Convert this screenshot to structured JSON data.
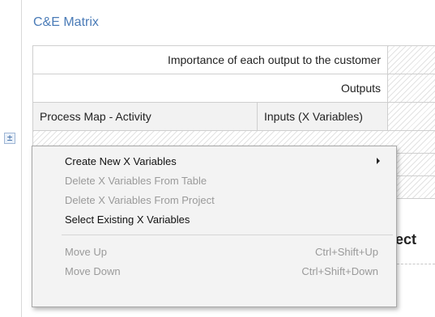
{
  "section": {
    "title": "C&E Matrix"
  },
  "matrix": {
    "importance_label": "Importance of each output to the customer",
    "outputs_label": "Outputs",
    "col_process_map": "Process Map - Activity",
    "col_inputs": "Inputs (X Variables)",
    "expand_symbol": "±"
  },
  "background": {
    "partial_heading": "ect"
  },
  "context_menu": {
    "items": [
      {
        "label": "Create New X Variables",
        "enabled": true,
        "submenu": true,
        "shortcut": ""
      },
      {
        "label": "Delete X Variables From Table",
        "enabled": false,
        "submenu": false,
        "shortcut": ""
      },
      {
        "label": "Delete X Variables From Project",
        "enabled": false,
        "submenu": false,
        "shortcut": ""
      },
      {
        "label": "Select Existing X Variables",
        "enabled": true,
        "submenu": false,
        "shortcut": ""
      },
      {
        "label": "Move Up",
        "enabled": false,
        "submenu": false,
        "shortcut": "Ctrl+Shift+Up"
      },
      {
        "label": "Move Down",
        "enabled": false,
        "submenu": false,
        "shortcut": "Ctrl+Shift+Down"
      }
    ]
  },
  "colors": {
    "title_blue": "#4a7bb7",
    "disabled_text": "#9a9a9a",
    "menu_background": "#f3f3f3",
    "header_grey": "#f2f2f2"
  }
}
